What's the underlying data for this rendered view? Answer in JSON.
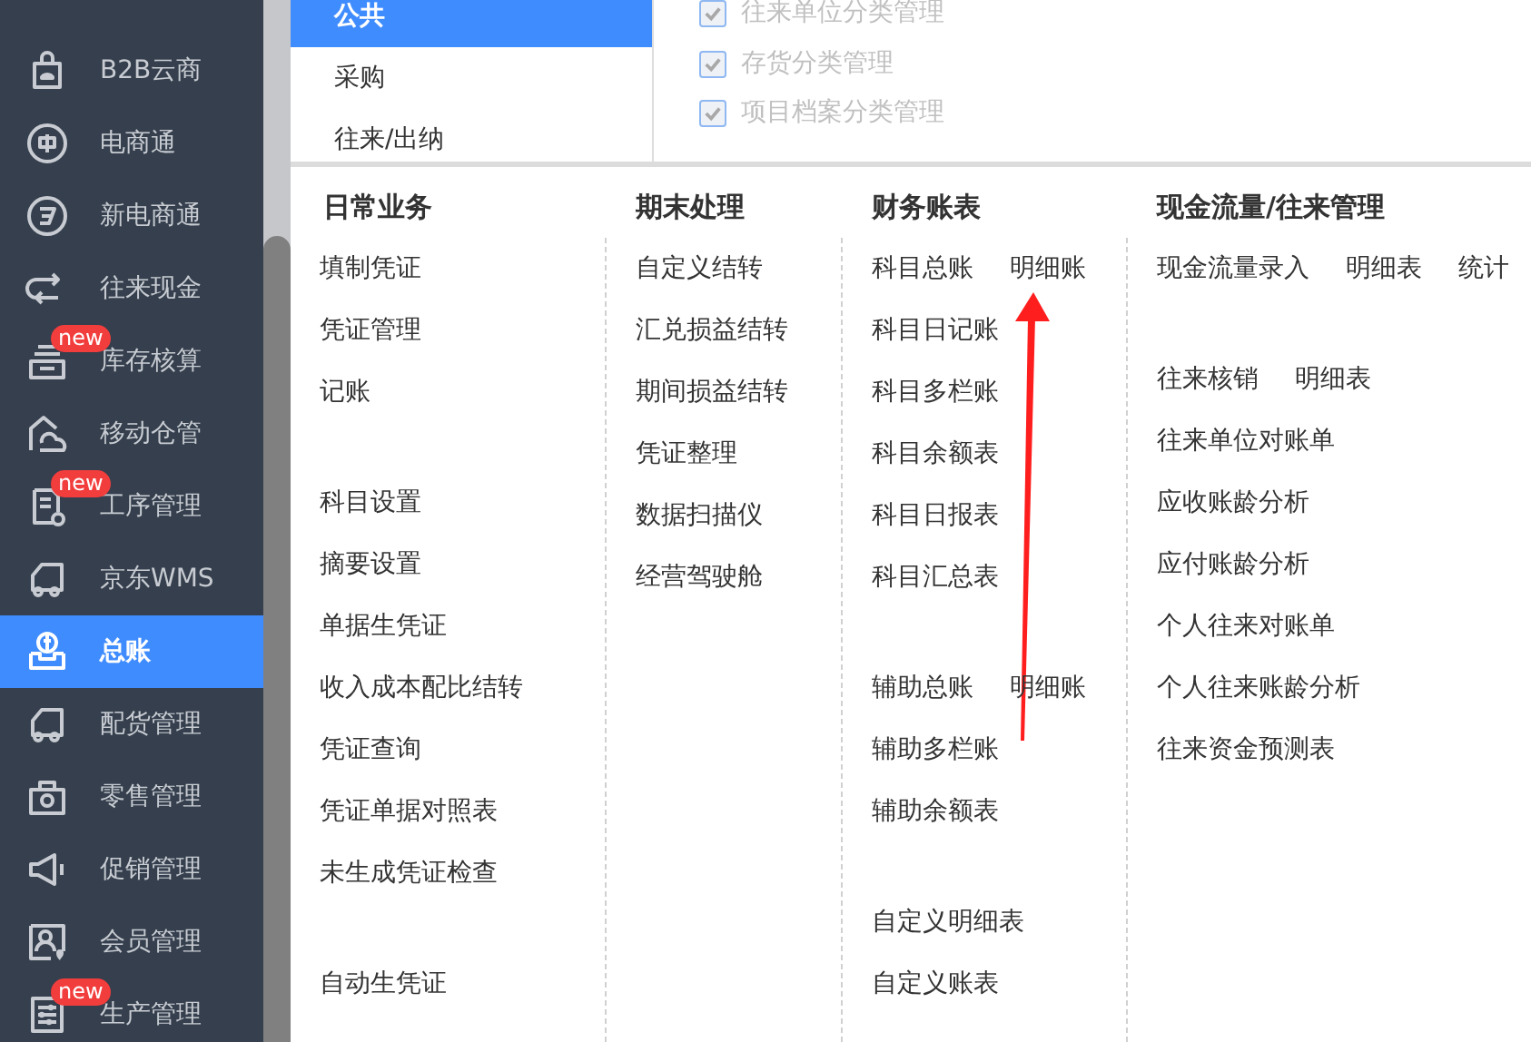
{
  "sidebar": {
    "items": [
      {
        "label": "B2B云商",
        "selected": false
      },
      {
        "label": "电商通",
        "selected": false
      },
      {
        "label": "新电商通",
        "selected": false
      },
      {
        "label": "往来现金",
        "selected": false
      },
      {
        "label": "库存核算",
        "selected": false,
        "badge": "new"
      },
      {
        "label": "移动仓管",
        "selected": false
      },
      {
        "label": "工序管理",
        "selected": false,
        "badge": "new"
      },
      {
        "label": "京东WMS",
        "selected": false
      },
      {
        "label": "总账",
        "selected": true
      },
      {
        "label": "配货管理",
        "selected": false
      },
      {
        "label": "零售管理",
        "selected": false
      },
      {
        "label": "促销管理",
        "selected": false
      },
      {
        "label": "会员管理",
        "selected": false
      },
      {
        "label": "生产管理",
        "selected": false,
        "badge": "new"
      }
    ]
  },
  "settings_panel": {
    "tabs": [
      {
        "label": "公共",
        "selected": true
      },
      {
        "label": "采购",
        "selected": false
      },
      {
        "label": "往来/出纳",
        "selected": false
      }
    ],
    "options": [
      {
        "label": "往来单位分类管理",
        "checked": true,
        "disabled": true
      },
      {
        "label": "存货分类管理",
        "checked": true,
        "disabled": true
      },
      {
        "label": "项目档案分类管理",
        "checked": true,
        "disabled": true
      }
    ]
  },
  "menu": {
    "columns": [
      {
        "title": "日常业务",
        "groups": [
          [
            [
              "填制凭证"
            ],
            [
              "凭证管理"
            ],
            [
              "记账"
            ]
          ],
          [
            [
              "科目设置"
            ],
            [
              "摘要设置"
            ],
            [
              "单据生凭证"
            ],
            [
              "收入成本配比结转"
            ],
            [
              "凭证查询"
            ],
            [
              "凭证单据对照表"
            ],
            [
              "未生成凭证检查"
            ]
          ],
          [
            [
              "自动生凭证"
            ]
          ]
        ]
      },
      {
        "title": "期末处理",
        "groups": [
          [
            [
              "自定义结转"
            ],
            [
              "汇兑损益结转"
            ],
            [
              "期间损益结转"
            ],
            [
              "凭证整理"
            ],
            [
              "数据扫描仪"
            ],
            [
              "经营驾驶舱"
            ]
          ]
        ]
      },
      {
        "title": "财务账表",
        "groups": [
          [
            [
              "科目总账",
              "明细账"
            ],
            [
              "科目日记账"
            ],
            [
              "科目多栏账"
            ],
            [
              "科目余额表"
            ],
            [
              "科目日报表"
            ],
            [
              "科目汇总表"
            ]
          ],
          [
            [
              "辅助总账",
              "明细账"
            ],
            [
              "辅助多栏账"
            ],
            [
              "辅助余额表"
            ]
          ],
          [
            [
              "自定义明细表"
            ],
            [
              "自定义账表"
            ]
          ]
        ]
      },
      {
        "title": "现金流量/往来管理",
        "groups": [
          [
            [
              "现金流量录入",
              "明细表",
              "统计"
            ]
          ],
          [
            [
              "往来核销",
              "明细表"
            ],
            [
              "往来单位对账单"
            ],
            [
              "应收账龄分析"
            ],
            [
              "应付账龄分析"
            ],
            [
              "个人往来对账单"
            ],
            [
              "个人往来账龄分析"
            ],
            [
              "往来资金预测表"
            ]
          ]
        ]
      }
    ]
  }
}
